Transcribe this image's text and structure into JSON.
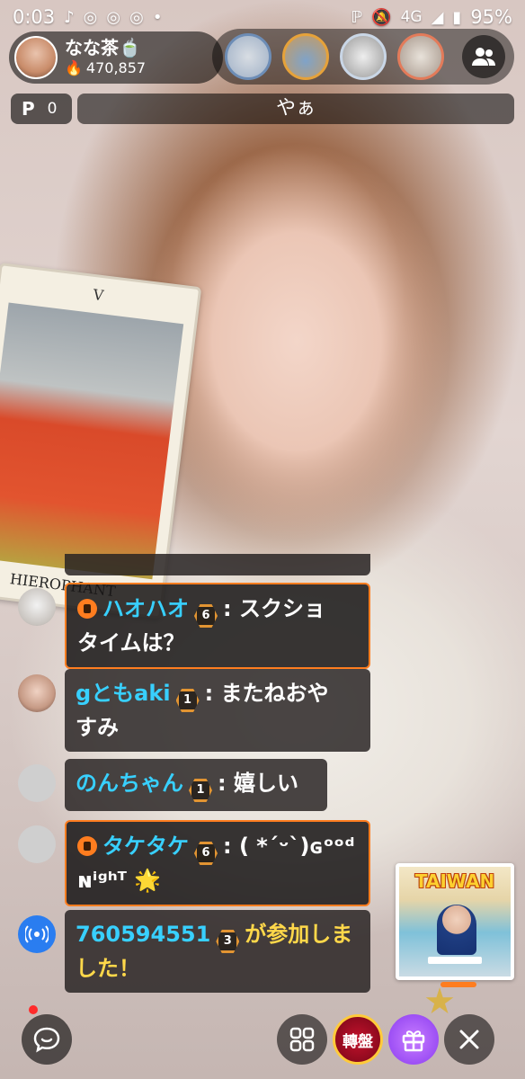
{
  "status_bar": {
    "time": "0:03",
    "network": "4G",
    "battery": "95%",
    "icons": [
      "tiktok-icon",
      "instagram-icon",
      "instagram-icon",
      "instagram-icon",
      "dot-icon",
      "nfc-icon",
      "mute-icon",
      "signal-icon",
      "battery-icon"
    ]
  },
  "host": {
    "name": "なな茶🍵",
    "fans": "470,857"
  },
  "viewers": [
    "viewer-1",
    "viewer-2",
    "viewer-3",
    "viewer-4"
  ],
  "points": {
    "icon": "P",
    "value": "0"
  },
  "stream_title": "やぁ",
  "card": {
    "numeral": "V",
    "name": "HIEROPHANT"
  },
  "chat": [
    {
      "user": "ハオハオ",
      "level": "6",
      "vip": true,
      "sep": ":",
      "text": "スクショタイムは？",
      "line1": "スクショ",
      "line2": "タイムは？"
    },
    {
      "user": "gともaki",
      "level": "1",
      "vip": false,
      "sep": ":",
      "line1": "またねおや",
      "line2": "すみ"
    },
    {
      "user": "のんちゃん",
      "level": "1",
      "vip": false,
      "sep": ":",
      "line1": "嬉しい"
    },
    {
      "user": "タケタケ",
      "level": "6",
      "vip": true,
      "sep": ":",
      "line1": "( *´ᵕ`)ɢᵒᵒᵈ",
      "line2": "ɴⁱᵍʰᵀ 🌟"
    },
    {
      "user": "760594551",
      "level": "3",
      "system": true,
      "line1": "が参加しま",
      "line2": "した！"
    }
  ],
  "promo": {
    "title": "TAIWAN"
  },
  "toolbar": {
    "wheel_label": "轉盤"
  },
  "colors": {
    "username": "#38d0ff",
    "system_text": "#ffd84a",
    "vip_border": "#ff7d1f",
    "gift_purple": "#8a3cf0",
    "wheel_red": "#c3122c"
  }
}
